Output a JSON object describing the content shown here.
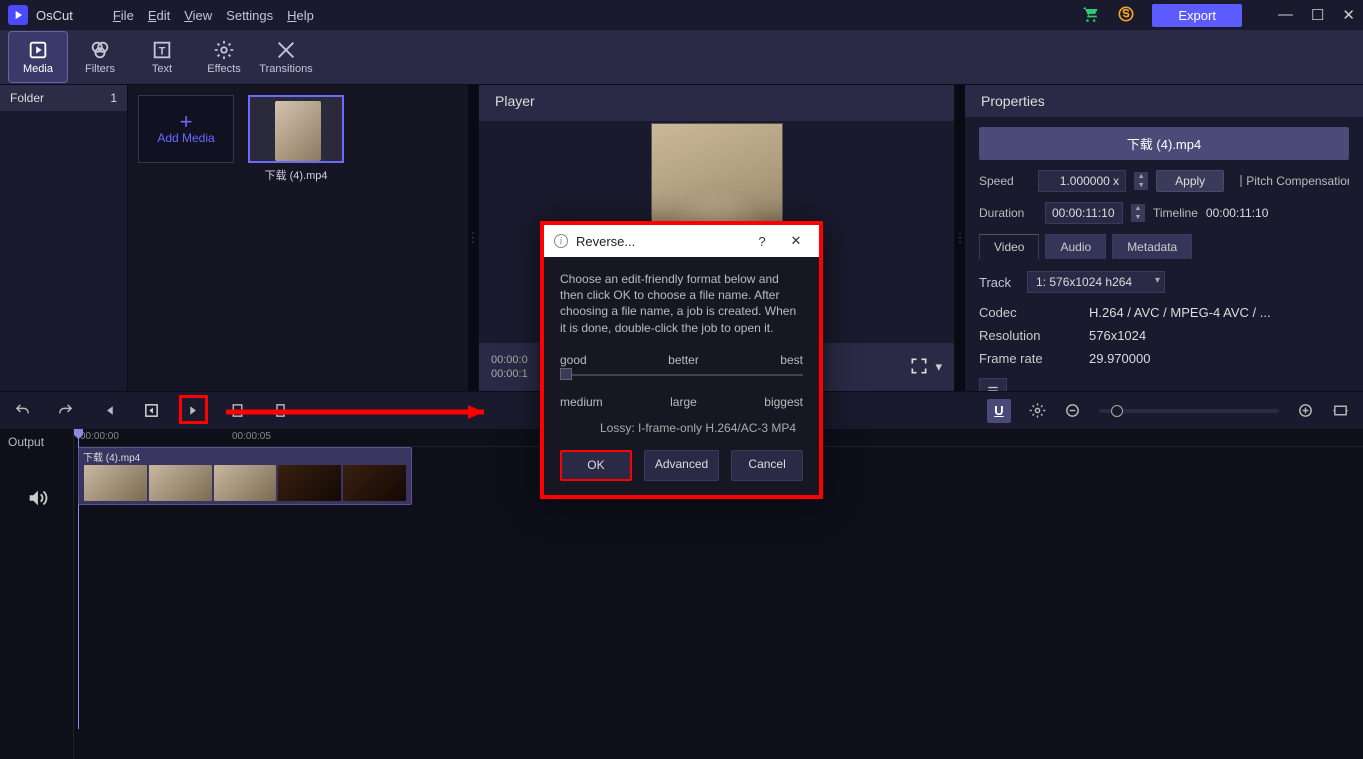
{
  "app": {
    "name": "OsCut"
  },
  "menu": {
    "file": "File",
    "edit": "Edit",
    "view": "View",
    "settings": "Settings",
    "help": "Help"
  },
  "titlebar": {
    "export": "Export"
  },
  "tabs": {
    "media": "Media",
    "filters": "Filters",
    "text": "Text",
    "effects": "Effects",
    "transitions": "Transitions"
  },
  "folders": {
    "label": "Folder",
    "count": "1"
  },
  "media": {
    "add": "Add Media",
    "clip1_name": "下载 (4).mp4"
  },
  "player": {
    "title": "Player",
    "timecode_a": "00:00:0",
    "timecode_b": "00:00:1"
  },
  "properties": {
    "title": "Properties",
    "filename": "下载 (4).mp4",
    "speed_label": "Speed",
    "speed_value": "1.000000 x",
    "apply": "Apply",
    "pitch": "Pitch Compensation",
    "duration_label": "Duration",
    "duration_value": "00:00:11:10",
    "timeline_label": "Timeline",
    "timeline_value": "00:00:11:10",
    "tab_video": "Video",
    "tab_audio": "Audio",
    "tab_metadata": "Metadata",
    "track_label": "Track",
    "track_value": "1: 576x1024 h264",
    "codec_label": "Codec",
    "codec_value": "H.264 / AVC / MPEG-4 AVC / ...",
    "res_label": "Resolution",
    "res_value": "576x1024",
    "fps_label": "Frame rate",
    "fps_value": "29.970000"
  },
  "timeline": {
    "output": "Output",
    "ruler_0": "00:00:00",
    "ruler_5": "00:00:05",
    "clip_name": "下载 (4).mp4"
  },
  "modal": {
    "title": "Reverse...",
    "desc": "Choose an edit-friendly format below and then click OK to choose a file name. After choosing a file name, a job is created. When it is done, double-click the job to open it.",
    "good": "good",
    "better": "better",
    "best": "best",
    "medium": "medium",
    "large": "large",
    "biggest": "biggest",
    "codec": "Lossy: I-frame-only H.264/AC-3 MP4",
    "ok": "OK",
    "advanced": "Advanced",
    "cancel": "Cancel"
  }
}
